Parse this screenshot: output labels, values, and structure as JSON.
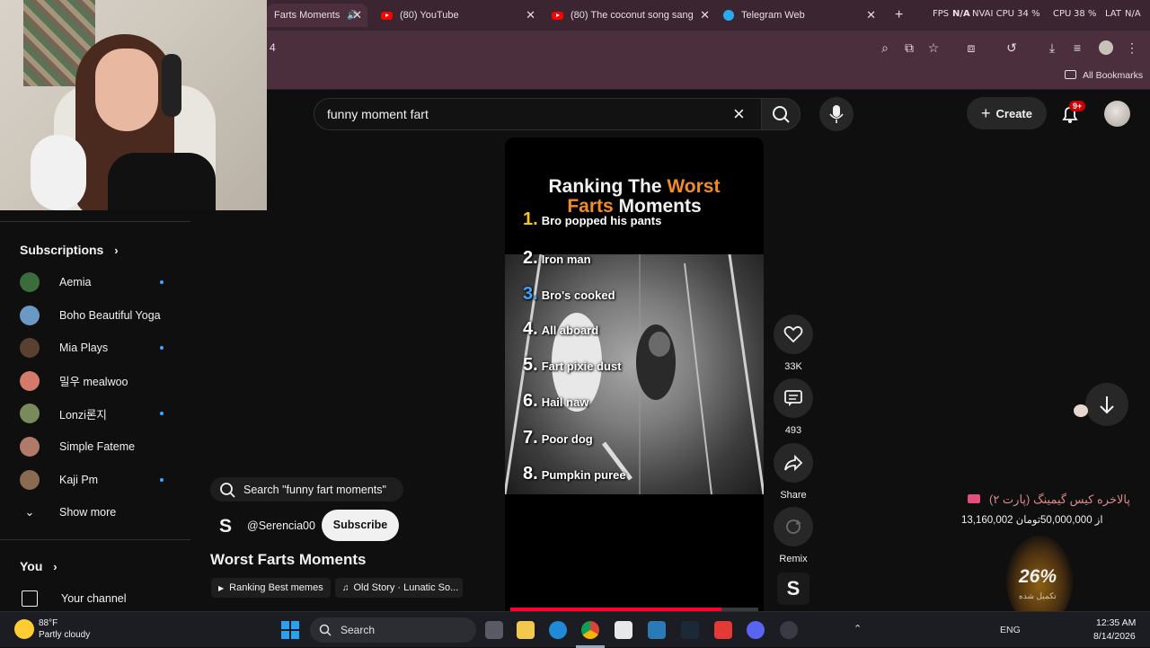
{
  "browser": {
    "tabs": [
      {
        "label": "Farts Moments"
      },
      {
        "label": "(80) YouTube"
      },
      {
        "label": "(80) The coconut song sang b"
      },
      {
        "label": "Telegram Web"
      }
    ],
    "new_tab": "+",
    "address_fragment": "4",
    "all_bookmarks": "All Bookmarks",
    "overlay_stats": {
      "fps": "FPS",
      "fps_value": "N/A",
      "gpu_fragment": "NVAI CPU 34 %",
      "cpu_label": "CPU",
      "cpu_value": "38 %",
      "lat_label": "LAT",
      "lat_value": "N/A",
      "gemini": "Ask Gemini"
    }
  },
  "search": {
    "query": "funny moment fart",
    "clear_icon": "close-icon",
    "search_icon": "search-icon",
    "mic_icon": "mic-icon"
  },
  "header": {
    "create_label": "Create",
    "notif_badge": "9+"
  },
  "sidebar": {
    "subscriptions_label": "Subscriptions",
    "items": [
      {
        "label": "Aemia",
        "dot": true,
        "color": "#3a6d3a"
      },
      {
        "label": "Boho Beautiful Yoga",
        "dot": false,
        "color": "#6a9ac4"
      },
      {
        "label": "Mia Plays",
        "dot": true,
        "color": "#5a4030"
      },
      {
        "label": "밀우 mealwoo",
        "dot": false,
        "color": "#d47a6a"
      },
      {
        "label": "Lonzi론지",
        "dot": true,
        "color": "#7a8a5a"
      },
      {
        "label": "Simple Fateme",
        "dot": false,
        "color": "#b07a6a"
      },
      {
        "label": "Kaji Pm",
        "dot": true,
        "color": "#8a6a50"
      }
    ],
    "show_more": "Show more",
    "you_label": "You",
    "your_channel": "Your channel"
  },
  "short": {
    "search_chip": "Search \"funny fart moments\"",
    "channel": "@Serencia00",
    "subscribe": "Subscribe",
    "title": "Worst Farts Moments",
    "chip_playlist": "Ranking Best memes",
    "chip_sound": "Old Story · Lunatic So...",
    "video_title_1a": "Ranking The ",
    "video_title_1b": "Worst",
    "video_title_2a": "Farts",
    "video_title_2b": " Moments",
    "ranks": [
      {
        "n": "1.",
        "t": "Bro popped his pants",
        "color": "#f5c518"
      },
      {
        "n": "2.",
        "t": "Iron man",
        "color": "#ffffff"
      },
      {
        "n": "3.",
        "t": "Bro's cooked",
        "color": "#3ea6ff"
      },
      {
        "n": "4.",
        "t": "All aboard",
        "color": "#ffffff"
      },
      {
        "n": "5.",
        "t": "Fart pixie dust",
        "color": "#ffffff"
      },
      {
        "n": "6.",
        "t": "Hail naw",
        "color": "#ffffff"
      },
      {
        "n": "7.",
        "t": "Poor dog",
        "color": "#ffffff"
      },
      {
        "n": "8.",
        "t": "Pumpkin puree",
        "color": "#ffffff"
      }
    ],
    "progress": 0.85,
    "actions": {
      "likes": "33K",
      "comments": "493",
      "share": "Share",
      "remix": "Remix"
    }
  },
  "overlay": {
    "donation_title": "پالاخره کیس گیمینگ (پارت ۲)",
    "donation_progress": "13,160,002 از 50,000,000تومان",
    "percent": "26%",
    "percent_sub": "تکمیل شده"
  },
  "taskbar": {
    "weather_temp": "88°F",
    "weather_desc": "Partly cloudy",
    "search": "Search",
    "lang": "ENG",
    "time": "12:35 AM",
    "date": "8/14/2026"
  }
}
